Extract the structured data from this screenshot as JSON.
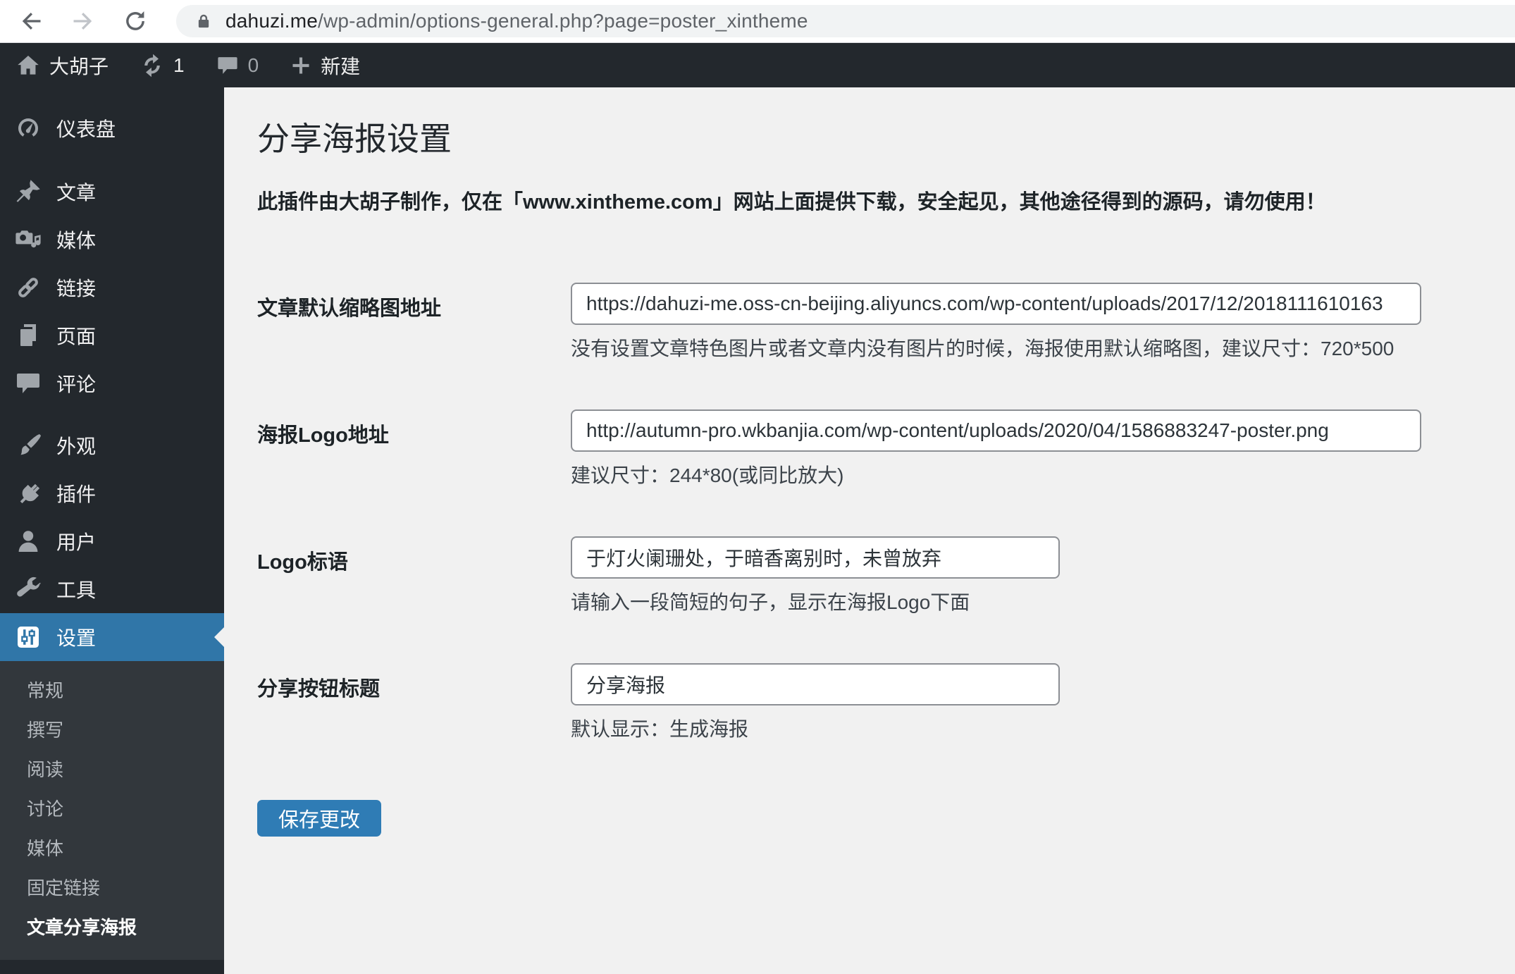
{
  "browser": {
    "url_host": "dahuzi.me",
    "url_path": "/wp-admin/options-general.php?page=poster_xintheme"
  },
  "admin_bar": {
    "site_name": "大胡子",
    "update_count": "1",
    "comment_count": "0",
    "new_label": "新建"
  },
  "sidebar": {
    "items": [
      {
        "label": "仪表盘",
        "icon": "gauge-icon"
      },
      {
        "label": "文章",
        "icon": "pin-icon"
      },
      {
        "label": "媒体",
        "icon": "camera-icon"
      },
      {
        "label": "链接",
        "icon": "link-icon"
      },
      {
        "label": "页面",
        "icon": "pages-icon"
      },
      {
        "label": "评论",
        "icon": "comment-icon"
      },
      {
        "label": "外观",
        "icon": "brush-icon"
      },
      {
        "label": "插件",
        "icon": "plug-icon"
      },
      {
        "label": "用户",
        "icon": "user-icon"
      },
      {
        "label": "工具",
        "icon": "wrench-icon"
      },
      {
        "label": "设置",
        "icon": "sliders-icon",
        "active": true
      }
    ],
    "submenu": [
      {
        "label": "常规"
      },
      {
        "label": "撰写"
      },
      {
        "label": "阅读"
      },
      {
        "label": "讨论"
      },
      {
        "label": "媒体"
      },
      {
        "label": "固定链接"
      },
      {
        "label": "文章分享海报",
        "current": true
      }
    ]
  },
  "main": {
    "title": "分享海报设置",
    "description": "此插件由大胡子制作，仅在「www.xintheme.com」网站上面提供下载，安全起见，其他途径得到的源码，请勿使用！",
    "fields": [
      {
        "label": "文章默认缩略图地址",
        "value": "https://dahuzi-me.oss-cn-beijing.aliyuncs.com/wp-content/uploads/2017/12/2018111610163",
        "helper": "没有设置文章特色图片或者文章内没有图片的时候，海报使用默认缩略图，建议尺寸：720*500"
      },
      {
        "label": "海报Logo地址",
        "value": "http://autumn-pro.wkbanjia.com/wp-content/uploads/2020/04/1586883247-poster.png",
        "helper": "建议尺寸：244*80(或同比放大)"
      },
      {
        "label": "Logo标语",
        "value": "于灯火阑珊处，于暗香离别时，未曾放弃",
        "helper": "请输入一段简短的句子，显示在海报Logo下面"
      },
      {
        "label": "分享按钮标题",
        "value": "分享海报",
        "helper": "默认显示：生成海报"
      }
    ],
    "save_label": "保存更改"
  },
  "colors": {
    "admin_bar_bg": "#23282d",
    "sidebar_bg": "#23282d",
    "submenu_bg": "#32373c",
    "menu_active_blue": "#3076a8",
    "button_blue": "#2f7cb5",
    "content_bg": "#f1f1f1"
  }
}
